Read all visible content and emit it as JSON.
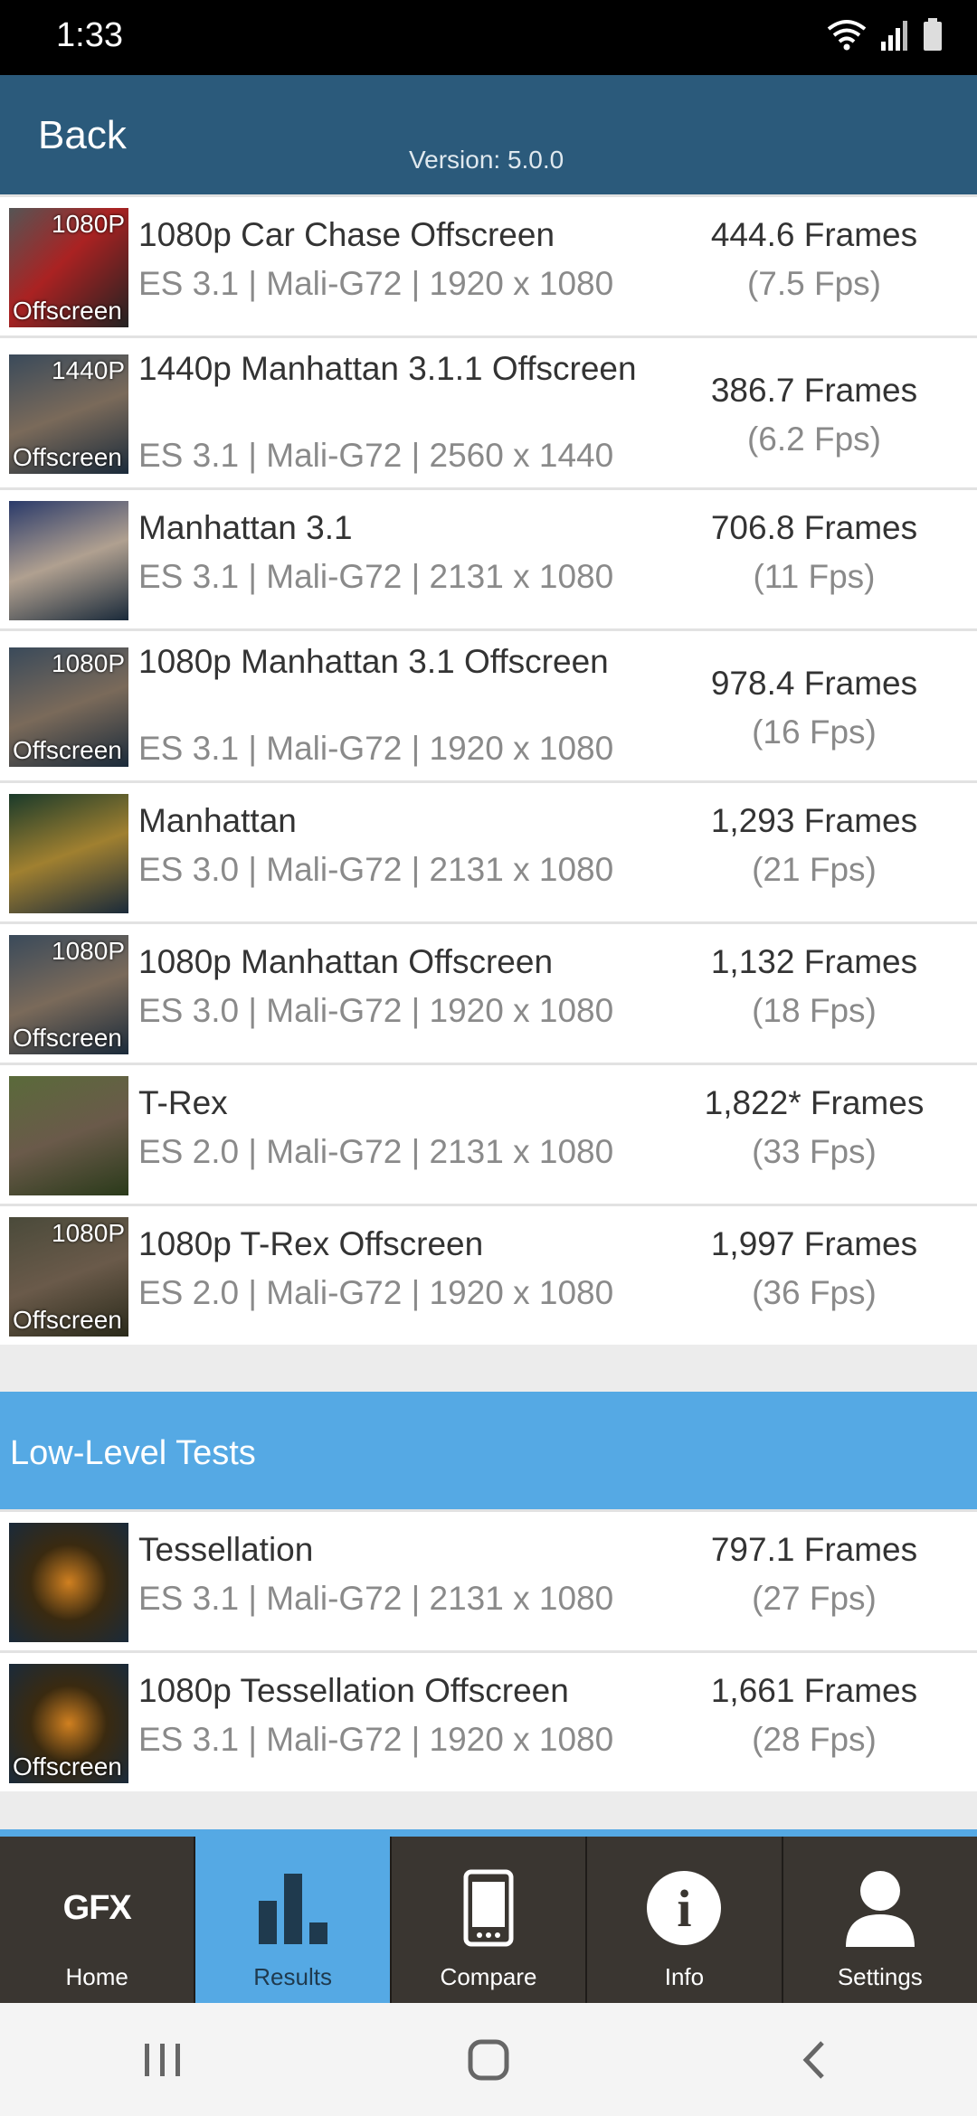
{
  "status_bar": {
    "time": "1:33"
  },
  "header": {
    "back_label": "Back",
    "version": "Version: 5.0.0"
  },
  "results": [
    {
      "thumb_top": "1080P",
      "thumb_bottom": "Offscreen",
      "name": "1080p Car Chase Offscreen",
      "spec": "ES 3.1 | Mali-G72 | 1920 x 1080",
      "frames": "444.6 Frames",
      "fps": "(7.5 Fps)"
    },
    {
      "thumb_top": "1440P",
      "thumb_bottom": "Offscreen",
      "name": "1440p Manhattan 3.1.1 Offscreen",
      "spec": "ES 3.1 | Mali-G72 | 2560 x 1440",
      "frames": "386.7 Frames",
      "fps": "(6.2 Fps)"
    },
    {
      "thumb_top": "",
      "thumb_bottom": "",
      "name": "Manhattan 3.1",
      "spec": "ES 3.1 | Mali-G72 | 2131 x 1080",
      "frames": "706.8 Frames",
      "fps": "(11 Fps)"
    },
    {
      "thumb_top": "1080P",
      "thumb_bottom": "Offscreen",
      "name": "1080p Manhattan 3.1 Offscreen",
      "spec": "ES 3.1 | Mali-G72 | 1920 x 1080",
      "frames": "978.4 Frames",
      "fps": "(16 Fps)"
    },
    {
      "thumb_top": "",
      "thumb_bottom": "",
      "name": "Manhattan",
      "spec": "ES 3.0 | Mali-G72 | 2131 x 1080",
      "frames": "1,293 Frames",
      "fps": "(21 Fps)"
    },
    {
      "thumb_top": "1080P",
      "thumb_bottom": "Offscreen",
      "name": "1080p Manhattan Offscreen",
      "spec": "ES 3.0 | Mali-G72 | 1920 x 1080",
      "frames": "1,132 Frames",
      "fps": "(18 Fps)"
    },
    {
      "thumb_top": "",
      "thumb_bottom": "",
      "name": "T-Rex",
      "spec": "ES 2.0 | Mali-G72 | 2131 x 1080",
      "frames": "1,822* Frames",
      "fps": "(33 Fps)"
    },
    {
      "thumb_top": "1080P",
      "thumb_bottom": "Offscreen",
      "name": "1080p T-Rex Offscreen",
      "spec": "ES 2.0 | Mali-G72 | 1920 x 1080",
      "frames": "1,997 Frames",
      "fps": "(36 Fps)"
    }
  ],
  "low_level": {
    "title": "Low-Level Tests",
    "items": [
      {
        "thumb_top": "",
        "thumb_bottom": "",
        "name": "Tessellation",
        "spec": "ES 3.1 | Mali-G72 | 2131 x 1080",
        "frames": "797.1 Frames",
        "fps": "(27 Fps)"
      },
      {
        "thumb_top": "",
        "thumb_bottom": "Offscreen",
        "name": "1080p Tessellation Offscreen",
        "spec": "ES 3.1 | Mali-G72 | 1920 x 1080",
        "frames": "1,661 Frames",
        "fps": "(28 Fps)"
      }
    ]
  },
  "tabs": {
    "home": {
      "label": "Home",
      "icon_text": "GFX"
    },
    "results": {
      "label": "Results"
    },
    "compare": {
      "label": "Compare"
    },
    "info": {
      "label": "Info",
      "icon_text": "i"
    },
    "settings": {
      "label": "Settings"
    }
  },
  "colors": {
    "header": "#2b5a7b",
    "accent": "#55a9e4",
    "tabbar": "#3a3631"
  }
}
